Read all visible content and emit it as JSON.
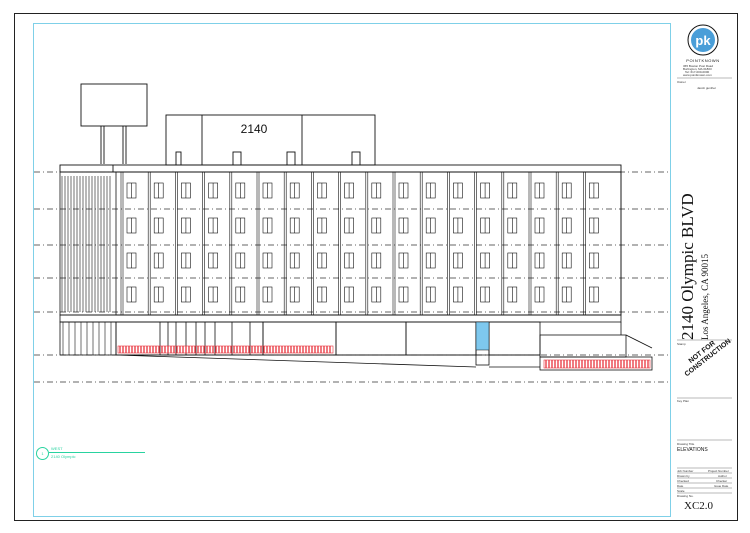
{
  "building": {
    "sign_text": "2140"
  },
  "title_block": {
    "logo_letters": "pk",
    "logo_name": "POINTKNOWN",
    "logo_line1": "365 Boston Post Road",
    "logo_line2": "Burlington, MA 01803",
    "logo_line3": "Tel: 617-000-0000",
    "logo_line4": "www.pointknown.com",
    "owner_label": "Owner",
    "owner_value": "Jacob gunther",
    "address_main": "2140 Olympic BLVD",
    "address_sub": "Los Angeles, CA 90015",
    "stamp_label": "Stamp",
    "not_for_construction": "NOT FOR CONSTRUCTION",
    "key_plan_label": "Key Plan",
    "drawing_title_label": "Drawing Title",
    "drawing_title": "ELEVATIONS",
    "job_number_label": "Job Number",
    "job_number_value": "Project Number",
    "drawn_by_label": "Drawn by",
    "drawn_by_value": "Author",
    "checked_label": "Checked",
    "checked_value": "Checker",
    "date_label": "Date",
    "date_value": "Issue Date",
    "scale_label": "Scale",
    "drawing_no_label": "Drawing No.",
    "sheet_number": "XC2.0"
  },
  "view_tag": {
    "number": "1",
    "title": "WEST",
    "subtitle": "2140 Olympic"
  },
  "colors": {
    "frame": "#222222",
    "drawing_border": "#7fd0e8",
    "hatch_red": "#e8323c",
    "glass_blue": "#7ec8ee",
    "tag_green": "#29d3a0"
  }
}
